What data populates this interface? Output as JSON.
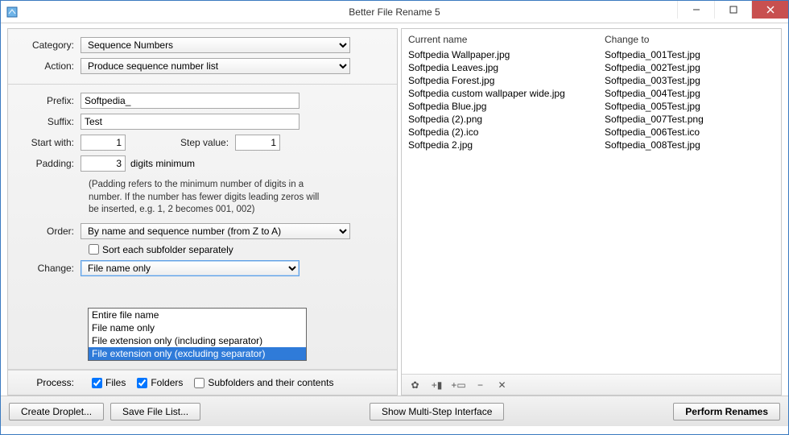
{
  "window": {
    "title": "Better File Rename 5"
  },
  "form": {
    "category_label": "Category:",
    "category_value": "Sequence Numbers",
    "action_label": "Action:",
    "action_value": "Produce sequence number list",
    "prefix_label": "Prefix:",
    "prefix_value": "Softpedia_",
    "suffix_label": "Suffix:",
    "suffix_value": "Test",
    "start_label": "Start with:",
    "start_value": "1",
    "step_label": "Step value:",
    "step_value": "1",
    "padding_label": "Padding:",
    "padding_value": "3",
    "digits_label": "digits minimum",
    "padding_hint": "(Padding refers to the minimum number of digits in a number. If the number has fewer digits leading zeros will be inserted, e.g. 1, 2 becomes 001, 002)",
    "order_label": "Order:",
    "order_value": "By name and sequence number (from Z to A)",
    "sort_subfolder_label": "Sort each subfolder separately",
    "change_label": "Change:",
    "change_value": "File name only",
    "change_options": [
      "Entire file name",
      "File name only",
      "File extension only (including separator)",
      "File extension only (excluding separator)"
    ],
    "change_selected_index": 3
  },
  "process": {
    "label": "Process:",
    "files": "Files",
    "folders": "Folders",
    "subfolders": "Subfolders and their contents"
  },
  "list": {
    "header_current": "Current name",
    "header_change": "Change to",
    "rows": [
      {
        "current": "Softpedia Wallpaper.jpg",
        "change": "Softpedia_001Test.jpg"
      },
      {
        "current": "Softpedia Leaves.jpg",
        "change": "Softpedia_002Test.jpg"
      },
      {
        "current": "Softpedia Forest.jpg",
        "change": "Softpedia_003Test.jpg"
      },
      {
        "current": "Softpedia custom wallpaper wide.jpg",
        "change": "Softpedia_004Test.jpg"
      },
      {
        "current": "Softpedia Blue.jpg",
        "change": "Softpedia_005Test.jpg"
      },
      {
        "current": "Softpedia (2).png",
        "change": "Softpedia_007Test.png"
      },
      {
        "current": "Softpedia (2).ico",
        "change": "Softpedia_006Test.ico"
      },
      {
        "current": "Softpedia 2.jpg",
        "change": "Softpedia_008Test.jpg"
      }
    ]
  },
  "buttons": {
    "create_droplet": "Create Droplet...",
    "save_file_list": "Save File List...",
    "show_multistep": "Show Multi-Step Interface",
    "perform": "Perform Renames"
  }
}
